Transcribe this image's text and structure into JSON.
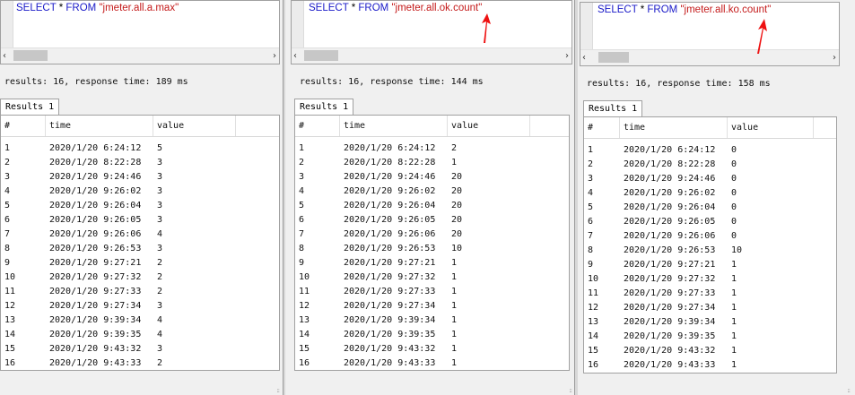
{
  "panels": [
    {
      "query": {
        "keyword1": "SELECT",
        "star": " * ",
        "keyword2": "FROM",
        "space": " ",
        "metric": "\"jmeter.all.a.max\""
      },
      "status": "results: 16, response time: 189 ms",
      "tab_label": "Results 1",
      "columns": [
        "#",
        "time",
        "value"
      ],
      "rows": [
        [
          "1",
          "2020/1/20 6:24:12",
          "5"
        ],
        [
          "2",
          "2020/1/20 8:22:28",
          "3"
        ],
        [
          "3",
          "2020/1/20 9:24:46",
          "3"
        ],
        [
          "4",
          "2020/1/20 9:26:02",
          "3"
        ],
        [
          "5",
          "2020/1/20 9:26:04",
          "3"
        ],
        [
          "6",
          "2020/1/20 9:26:05",
          "3"
        ],
        [
          "7",
          "2020/1/20 9:26:06",
          "4"
        ],
        [
          "8",
          "2020/1/20 9:26:53",
          "3"
        ],
        [
          "9",
          "2020/1/20 9:27:21",
          "2"
        ],
        [
          "10",
          "2020/1/20 9:27:32",
          "2"
        ],
        [
          "11",
          "2020/1/20 9:27:33",
          "2"
        ],
        [
          "12",
          "2020/1/20 9:27:34",
          "3"
        ],
        [
          "13",
          "2020/1/20 9:39:34",
          "4"
        ],
        [
          "14",
          "2020/1/20 9:39:35",
          "4"
        ],
        [
          "15",
          "2020/1/20 9:43:32",
          "3"
        ],
        [
          "16",
          "2020/1/20 9:43:33",
          "2"
        ]
      ]
    },
    {
      "query": {
        "keyword1": "SELECT",
        "star": " * ",
        "keyword2": "FROM",
        "space": " ",
        "metric": "\"jmeter.all.ok.count\""
      },
      "status": "results: 16, response time: 144 ms",
      "tab_label": "Results 1",
      "columns": [
        "#",
        "time",
        "value"
      ],
      "rows": [
        [
          "1",
          "2020/1/20 6:24:12",
          "2"
        ],
        [
          "2",
          "2020/1/20 8:22:28",
          "1"
        ],
        [
          "3",
          "2020/1/20 9:24:46",
          "20"
        ],
        [
          "4",
          "2020/1/20 9:26:02",
          "20"
        ],
        [
          "5",
          "2020/1/20 9:26:04",
          "20"
        ],
        [
          "6",
          "2020/1/20 9:26:05",
          "20"
        ],
        [
          "7",
          "2020/1/20 9:26:06",
          "20"
        ],
        [
          "8",
          "2020/1/20 9:26:53",
          "10"
        ],
        [
          "9",
          "2020/1/20 9:27:21",
          "1"
        ],
        [
          "10",
          "2020/1/20 9:27:32",
          "1"
        ],
        [
          "11",
          "2020/1/20 9:27:33",
          "1"
        ],
        [
          "12",
          "2020/1/20 9:27:34",
          "1"
        ],
        [
          "13",
          "2020/1/20 9:39:34",
          "1"
        ],
        [
          "14",
          "2020/1/20 9:39:35",
          "1"
        ],
        [
          "15",
          "2020/1/20 9:43:32",
          "1"
        ],
        [
          "16",
          "2020/1/20 9:43:33",
          "1"
        ]
      ]
    },
    {
      "query": {
        "keyword1": "SELECT",
        "star": " * ",
        "keyword2": "FROM",
        "space": " ",
        "metric": "\"jmeter.all.ko.count\""
      },
      "status": "results: 16, response time: 158 ms",
      "tab_label": "Results 1",
      "columns": [
        "#",
        "time",
        "value"
      ],
      "rows": [
        [
          "1",
          "2020/1/20 6:24:12",
          "0"
        ],
        [
          "2",
          "2020/1/20 8:22:28",
          "0"
        ],
        [
          "3",
          "2020/1/20 9:24:46",
          "0"
        ],
        [
          "4",
          "2020/1/20 9:26:02",
          "0"
        ],
        [
          "5",
          "2020/1/20 9:26:04",
          "0"
        ],
        [
          "6",
          "2020/1/20 9:26:05",
          "0"
        ],
        [
          "7",
          "2020/1/20 9:26:06",
          "0"
        ],
        [
          "8",
          "2020/1/20 9:26:53",
          "10"
        ],
        [
          "9",
          "2020/1/20 9:27:21",
          "1"
        ],
        [
          "10",
          "2020/1/20 9:27:32",
          "1"
        ],
        [
          "11",
          "2020/1/20 9:27:33",
          "1"
        ],
        [
          "12",
          "2020/1/20 9:27:34",
          "1"
        ],
        [
          "13",
          "2020/1/20 9:39:34",
          "1"
        ],
        [
          "14",
          "2020/1/20 9:39:35",
          "1"
        ],
        [
          "15",
          "2020/1/20 9:43:32",
          "1"
        ],
        [
          "16",
          "2020/1/20 9:43:33",
          "1"
        ]
      ]
    }
  ],
  "scroll_arrows": {
    "left": "‹",
    "right": "›"
  },
  "grip": "::",
  "colors": {
    "keyword": "#1a1ac8",
    "string": "#c41a1a",
    "annotation_arrow": "#ee1111"
  },
  "icons": [
    "scroll-left-arrow-icon",
    "scroll-right-arrow-icon",
    "red-arrow-annotation-icon",
    "resize-grip-icon"
  ]
}
